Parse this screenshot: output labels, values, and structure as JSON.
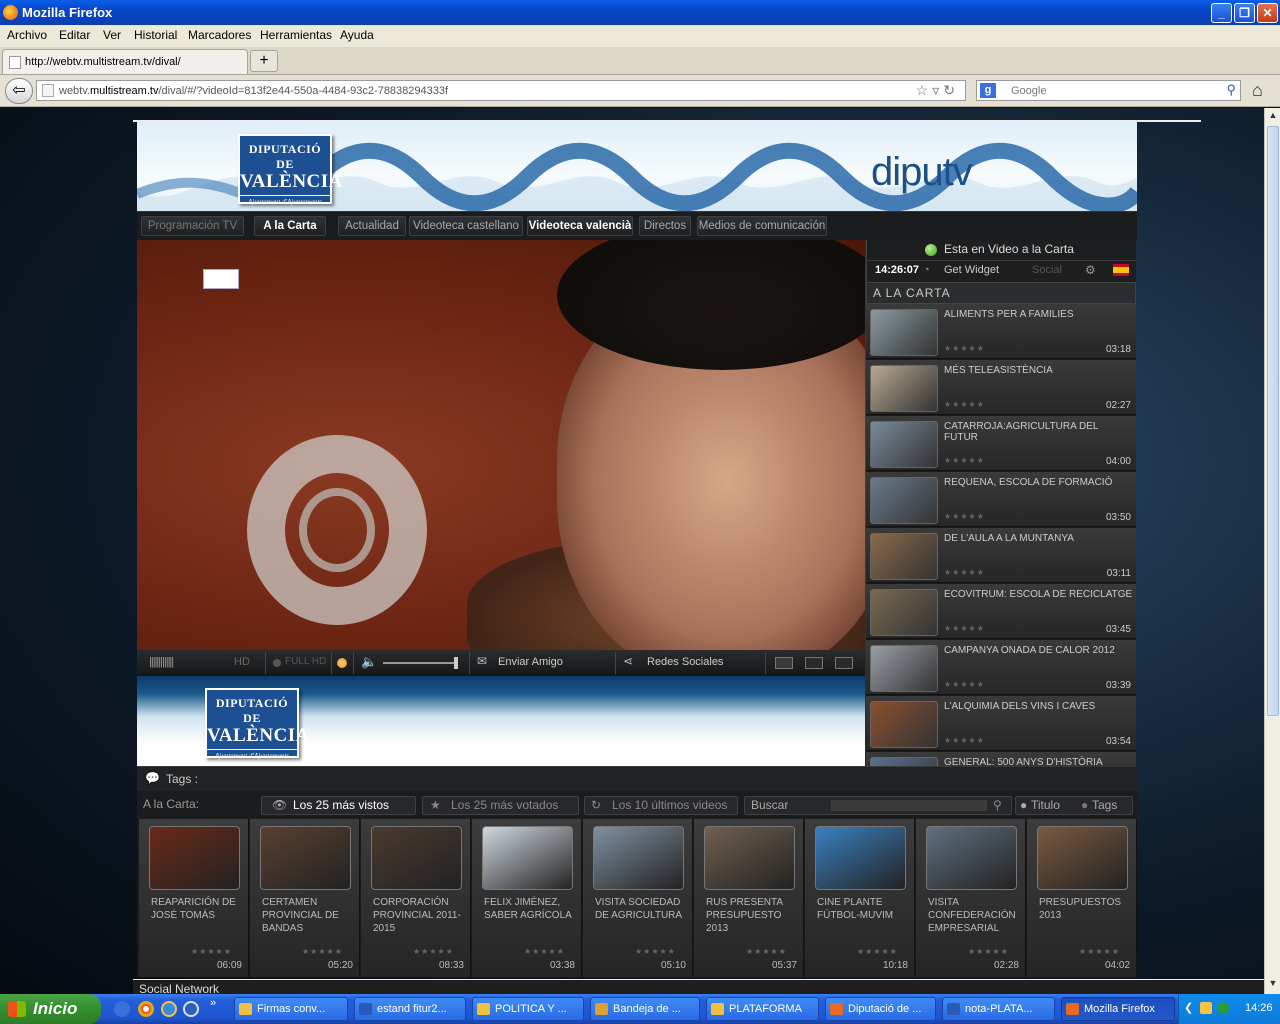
{
  "window": {
    "title": "Mozilla Firefox"
  },
  "menu": [
    "Archivo",
    "Editar",
    "Ver",
    "Historial",
    "Marcadores",
    "Herramientas",
    "Ayuda"
  ],
  "tab": {
    "title": "http://webtv.multistream.tv/dival/",
    "new_tab": "+"
  },
  "address": {
    "prefix": "webtv.",
    "domain": "multistream.tv",
    "path": "/dival/#/?videoId=813f2e44-550a-4484-93c2-78838294333f"
  },
  "search": {
    "engine": "g",
    "placeholder": "Google"
  },
  "banner": {
    "logo_line1": "DIPUTACIÓ DE",
    "logo_line2": "VALÈNCIA",
    "logo_line3": "Ajuntament d'Ajuntaments",
    "brand": "diputv"
  },
  "nav": {
    "tabs": [
      "Programación TV",
      "A la Carta",
      "Actualidad",
      "Videoteca castellano",
      "Videoteca valencià",
      "Directos",
      "Medios de comunicación"
    ]
  },
  "player": {
    "hd": "HD",
    "full_hd": "FULL HD",
    "send_friend": "Enviar Amigo",
    "social": "Redes Sociales"
  },
  "sidebar": {
    "live_label": "Esta en Video a la Carta",
    "clock": "14:26:07",
    "widget": "Get Widget",
    "social": "Social",
    "section": "A LA CARTA",
    "items": [
      {
        "title": "ALIMENTS PER A FAMILIES",
        "duration": "03:18"
      },
      {
        "title": "MÉS TELEASISTÈNCIA",
        "duration": "02:27"
      },
      {
        "title": "CATARROJA:AGRICULTURA DEL FUTUR",
        "duration": "04:00"
      },
      {
        "title": "REQUENA, ESCOLA DE FORMACIÓ",
        "duration": "03:50"
      },
      {
        "title": "DE L'AULA A LA MUNTANYA",
        "duration": "03:11"
      },
      {
        "title": "ECOVITRUM: ESCOLA DE RECICLATGE",
        "duration": "03:45"
      },
      {
        "title": "CAMPANYA ONADA DE CALOR 2012",
        "duration": "03:39"
      },
      {
        "title": "L'ALQUIMIA DELS VINS I CAVES",
        "duration": "03:54"
      },
      {
        "title": "GENERAL: 500 ANYS D'HISTÒRIA",
        "duration": ""
      }
    ]
  },
  "tags": {
    "label": "Tags :"
  },
  "filters": {
    "label": "A la Carta:",
    "top_viewed": "Los 25 más vistos",
    "top_voted": "Los 25 más votados",
    "latest": "Los 10 últimos videos",
    "search_placeholder": "Buscar",
    "opt_title": "Titulo",
    "opt_tags": "Tags"
  },
  "grid": [
    {
      "title": "REAPARICIÓN DE JOSÉ TOMÁS",
      "duration": "06:09"
    },
    {
      "title": "CERTAMEN PROVINCIAL DE BANDAS",
      "duration": "05:20"
    },
    {
      "title": "CORPORACIÓN PROVINCIAL 2011-2015",
      "duration": "08:33"
    },
    {
      "title": "FELIX JIMÉNEZ, SABER AGRÍCOLA",
      "duration": "03:38"
    },
    {
      "title": "VISITA SOCIEDAD DE AGRICULTURA",
      "duration": "05:10"
    },
    {
      "title": "RUS PRESENTA PRESUPUESTO 2013",
      "duration": "05:37"
    },
    {
      "title": "CINE PLANTE FÚTBOL-MUVIM",
      "duration": "10:18"
    },
    {
      "title": "VISITA CONFEDERACIÓN EMPRESARIAL",
      "duration": "02:28"
    },
    {
      "title": "PRESUPUESTOS 2013",
      "duration": "04:02"
    }
  ],
  "footer": {
    "social_network": "Social Network"
  },
  "taskbar": {
    "start": "Inicio",
    "buttons": [
      "Firmas conv...",
      "estand fitur2...",
      "POLITICA Y ...",
      "Bandeja de ...",
      "PLATAFORMA",
      "Diputació de ...",
      "nota-PLATA...",
      "Mozilla Firefox"
    ],
    "clock": "14:26"
  }
}
